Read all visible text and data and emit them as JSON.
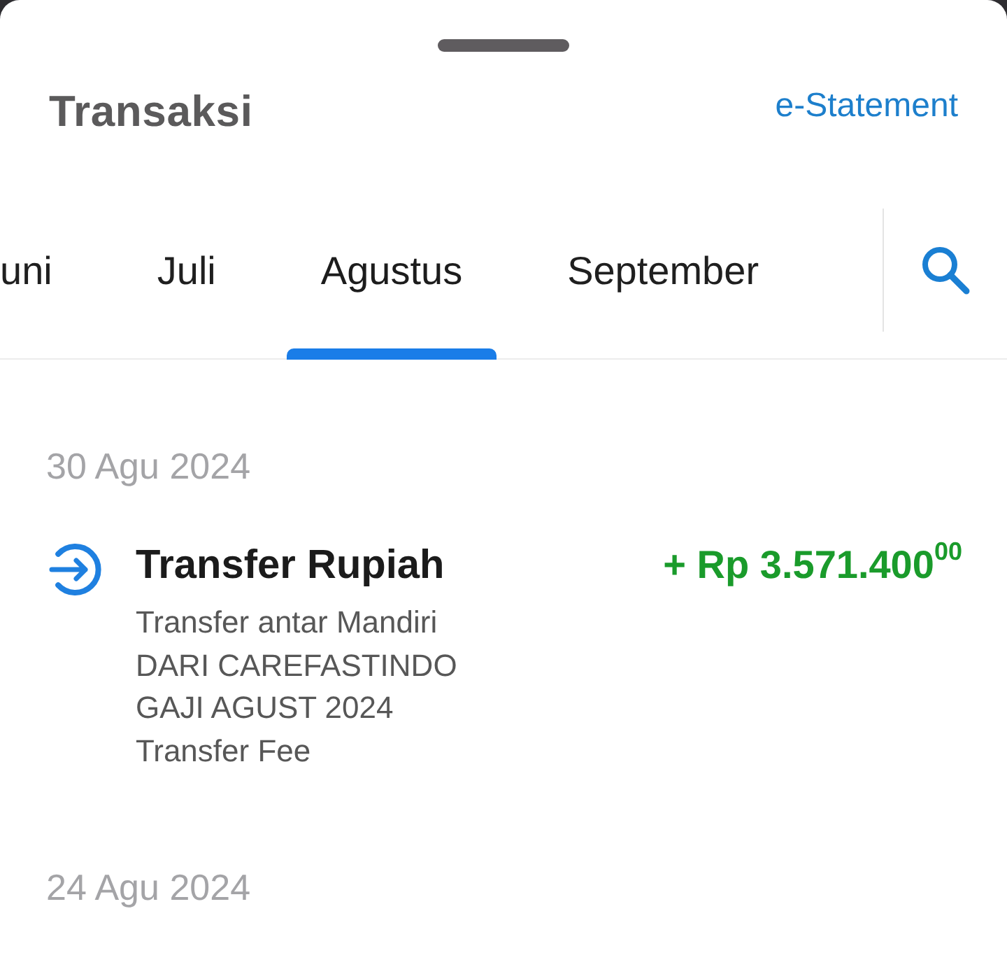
{
  "header": {
    "title": "Transaksi",
    "link": "e-Statement"
  },
  "month_tabs": [
    {
      "label": "uni",
      "selected": false
    },
    {
      "label": "Juli",
      "selected": false
    },
    {
      "label": "Agustus",
      "selected": true
    },
    {
      "label": "September",
      "selected": false
    }
  ],
  "groups": [
    {
      "date": "30 Agu 2024",
      "transactions": [
        {
          "kind": "credit",
          "title": "Transfer Rupiah",
          "amount": "+ Rp 3.571.400$^{00}$",
          "details": [
            "Transfer antar Mandiri",
            "DARI CAREFASTINDO",
            "GAJI AGUST 2024",
            "Transfer Fee"
          ]
        }
      ]
    },
    {
      "date": "24 Agu 2024"
    }
  ]
}
